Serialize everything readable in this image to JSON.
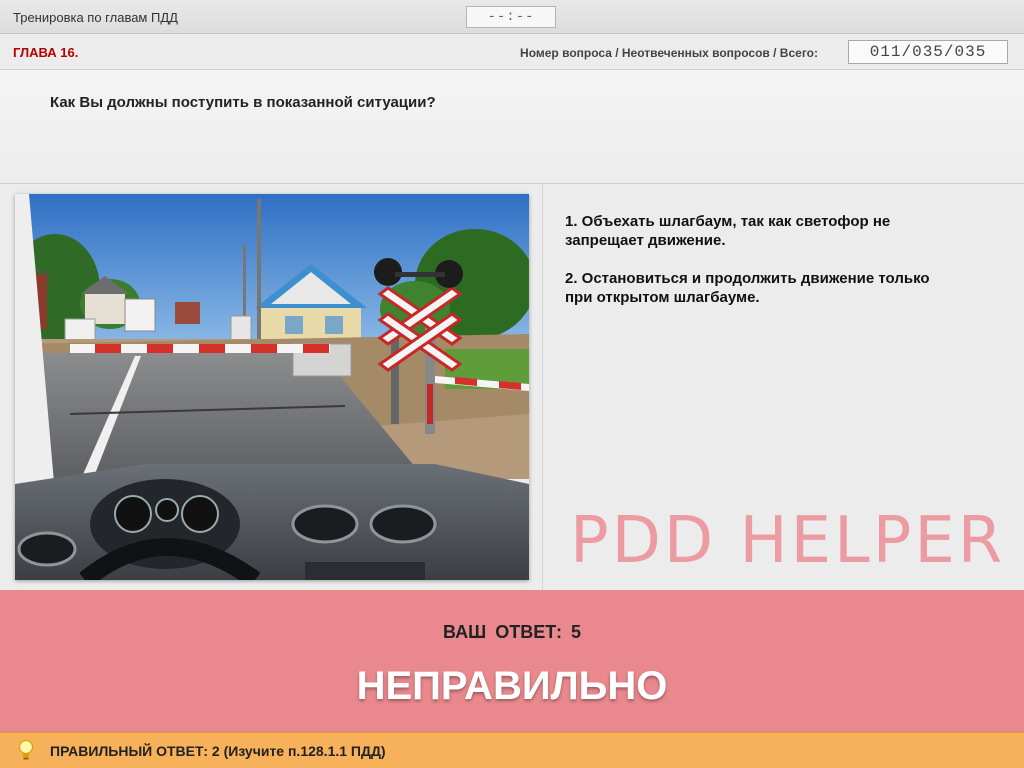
{
  "header": {
    "app_title": "Тренировка по главам ПДД",
    "timer": "--:--"
  },
  "chapter_bar": {
    "chapter": "ГЛАВА 16.",
    "counter_label": "Номер вопроса / Неотвеченных вопросов / Всего:",
    "counter": "011/035/035"
  },
  "question": {
    "text": "Как Вы должны поступить в показанной ситуации?"
  },
  "answers": [
    {
      "label": "1.  Объехать шлагбаум, так как светофор не\nзапрещает движение."
    },
    {
      "label": "2.  Остановиться и продолжить движение только\nпри открытом шлагбауме."
    }
  ],
  "watermark": "PDD HELPER",
  "result": {
    "your_answer": "ВАШ ОТВЕТ:  5",
    "verdict": "НЕПРАВИЛЬНО"
  },
  "hint": {
    "text": "ПРАВИЛЬНЫЙ ОТВЕТ:   2   (Изучите п.128.1.1 ПДД)",
    "icon": "lightbulb-icon"
  },
  "colors": {
    "chapter": "#b40000",
    "result_bg": "#ea898d",
    "hint_bg": "#f6b15a",
    "watermark": "#ee8e96"
  }
}
